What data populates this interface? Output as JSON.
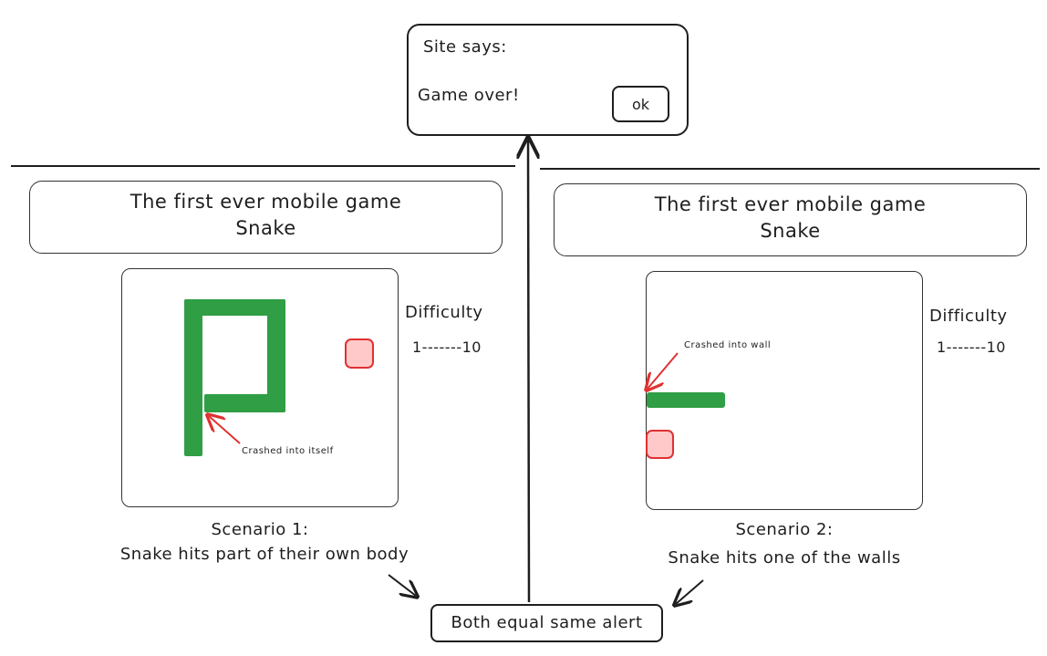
{
  "alert": {
    "header": "Site says:",
    "message": "Game over!",
    "ok_label": "ok"
  },
  "scenarios": [
    {
      "game_title_line1": "The first ever mobile game",
      "game_title_line2": "Snake",
      "difficulty_label": "Difficulty",
      "difficulty_scale": "1-------10",
      "annotation": "Crashed into itself",
      "caption_line1": "Scenario 1:",
      "caption_line2": "Snake hits part of their own body"
    },
    {
      "game_title_line1": "The first ever mobile game",
      "game_title_line2": "Snake",
      "difficulty_label": "Difficulty",
      "difficulty_scale": "1-------10",
      "annotation": "Crashed into wall",
      "caption_line1": "Scenario 2:",
      "caption_line2": "Snake hits one of the walls"
    }
  ],
  "result": "Both equal same alert",
  "colors": {
    "snake": "#2f9e44",
    "food_fill": "#ffc9c9",
    "food_border": "#e03131",
    "arrow_red": "#e03131",
    "stroke": "#1e1e1e"
  }
}
